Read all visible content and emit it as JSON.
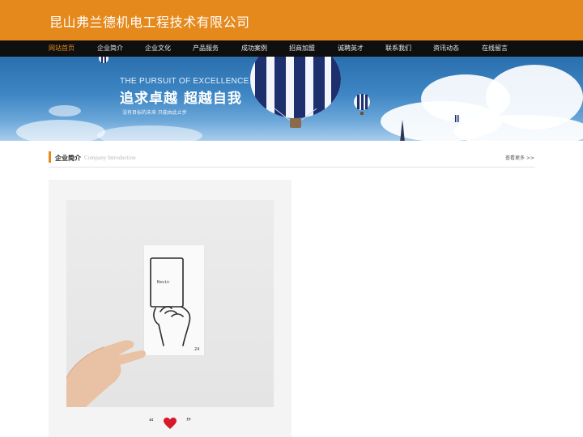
{
  "site": {
    "title": "昆山弗兰德机电工程技术有限公司"
  },
  "nav": {
    "items": [
      {
        "label": "网站首页",
        "active": true
      },
      {
        "label": "企业简介"
      },
      {
        "label": "企业文化"
      },
      {
        "label": "产品服务"
      },
      {
        "label": "成功案例"
      },
      {
        "label": "招商加盟"
      },
      {
        "label": "诚聘英才"
      },
      {
        "label": "联系我们"
      },
      {
        "label": "资讯动态"
      },
      {
        "label": "在线留言"
      }
    ]
  },
  "banner": {
    "en_slogan": "THE PURSUIT OF EXCELLENCE",
    "cn_slogan": "追求卓越  超越自我",
    "sub_slogan": "没有目标的未来  只能由此止步"
  },
  "about": {
    "title": "企业简介",
    "subtitle": "Company Introduction",
    "more": "查看更多 >>"
  },
  "photo": {
    "card_text": "Kevin",
    "card_number": "24",
    "quote_open": "“",
    "quote_close": "”"
  },
  "colors": {
    "brand": "#e5891c",
    "nav_bg": "#0f0f0f",
    "heart": "#d8192a"
  }
}
